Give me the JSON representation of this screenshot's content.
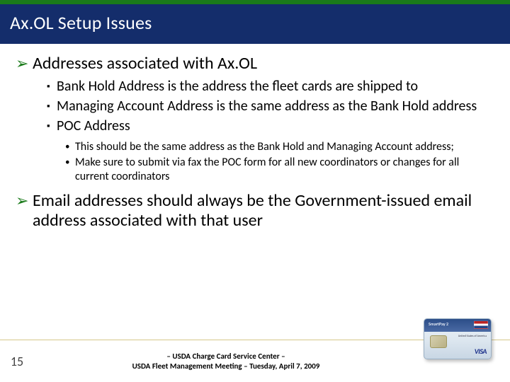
{
  "header": {
    "title": "Ax.OL Setup Issues"
  },
  "content": {
    "arrow1": "Addresses associated with Ax.OL",
    "squares": {
      "s1": "Bank Hold Address is the address the fleet cards are shipped to",
      "s2": "Managing Account Address is the same address as the Bank Hold address",
      "s3": "POC Address"
    },
    "dots": {
      "d1": "This should be the same address as the Bank Hold and Managing Account address;",
      "d2": "Make sure to submit via fax the POC form for all new coordinators or changes for all current coordinators"
    },
    "arrow2": "Email addresses should always be the Government-issued email address associated with that user"
  },
  "footer": {
    "page": "15",
    "line1": "– USDA Charge Card Service Center –",
    "line2": "USDA Fleet Management Meeting – Tuesday, April 7, 2009"
  },
  "card": {
    "brand": "SmartPay 2",
    "network": "VISA",
    "micro": "United States of America"
  },
  "glyphs": {
    "arrow": "➢",
    "square": "▪",
    "dot": "•"
  }
}
